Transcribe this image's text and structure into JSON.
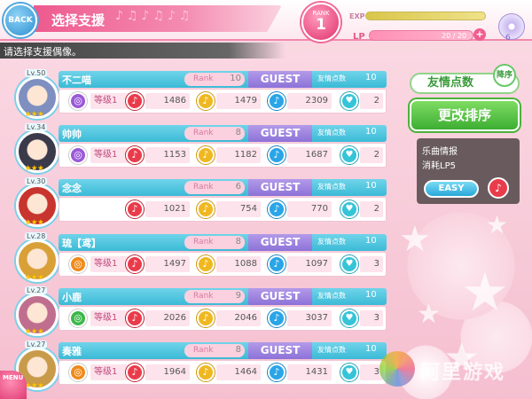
{
  "header": {
    "back_label": "BACK",
    "title": "选择支援",
    "notes": "♪♫♪♫♪♫",
    "rank_label": "RANK",
    "rank_value": "1",
    "exp_label": "EXP",
    "lp_label": "LP",
    "lp_value": "20 / 20",
    "lp_plus": "+",
    "disc_count": "6"
  },
  "subtitle": "请选择支援偶像。",
  "labels": {
    "rank": "Rank",
    "guest": "GUEST",
    "friend_points": "友情点数"
  },
  "rows": [
    {
      "lv": "Lv.50",
      "name": "不二喵",
      "rank": "10",
      "friend": "10",
      "skill": "等级1",
      "red": "1486",
      "yellow": "1479",
      "blue": "2309",
      "heart": "2",
      "skill_color": "#9b59d8"
    },
    {
      "lv": "Lv.34",
      "name": "帅帅",
      "rank": "8",
      "friend": "10",
      "skill": "等级1",
      "red": "1153",
      "yellow": "1182",
      "blue": "1687",
      "heart": "2",
      "skill_color": "#9b59d8"
    },
    {
      "lv": "Lv.30",
      "name": "念念",
      "rank": "6",
      "friend": "10",
      "skill": "",
      "red": "1021",
      "yellow": "754",
      "blue": "770",
      "heart": "2",
      "skill_color": ""
    },
    {
      "lv": "Lv.28",
      "name": "琉【鸢】",
      "rank": "8",
      "friend": "10",
      "skill": "等级1",
      "red": "1497",
      "yellow": "1088",
      "blue": "1097",
      "heart": "3",
      "skill_color": "#f08a1a"
    },
    {
      "lv": "Lv.27",
      "name": "小鹿",
      "rank": "9",
      "friend": "10",
      "skill": "等级1",
      "red": "2026",
      "yellow": "2046",
      "blue": "3037",
      "heart": "3",
      "skill_color": "#3cb84a"
    },
    {
      "lv": "Lv.27",
      "name": "奏雅",
      "rank": "8",
      "friend": "10",
      "skill": "等级1",
      "red": "1964",
      "yellow": "1464",
      "blue": "1431",
      "heart": "3",
      "skill_color": "#f08a1a"
    }
  ],
  "side": {
    "friend_points_btn": "友情点数",
    "sort_badge": "降序",
    "change_sort_btn": "更改排序",
    "song_info": "乐曲情报",
    "song_cost": "消耗LP5",
    "difficulty": "EASY"
  },
  "menu_label": "MENU",
  "watermark": "阿里游戏"
}
